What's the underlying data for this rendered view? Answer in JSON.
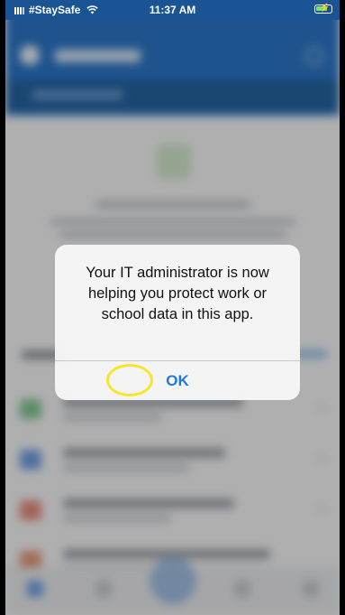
{
  "status_bar": {
    "carrier": "#StaySafe",
    "time": "11:37 AM"
  },
  "alert": {
    "message": "Your IT administrator is now helping you protect work or school data in this app.",
    "ok_label": "OK"
  },
  "colors": {
    "app_blue": "#2b74c4",
    "ios_link_blue": "#1f7ad9",
    "highlight": "#f7e52b"
  },
  "icons": {
    "wifi": "wifi-icon",
    "battery": "battery-charging-icon",
    "signal": "cellular-signal-icon"
  }
}
